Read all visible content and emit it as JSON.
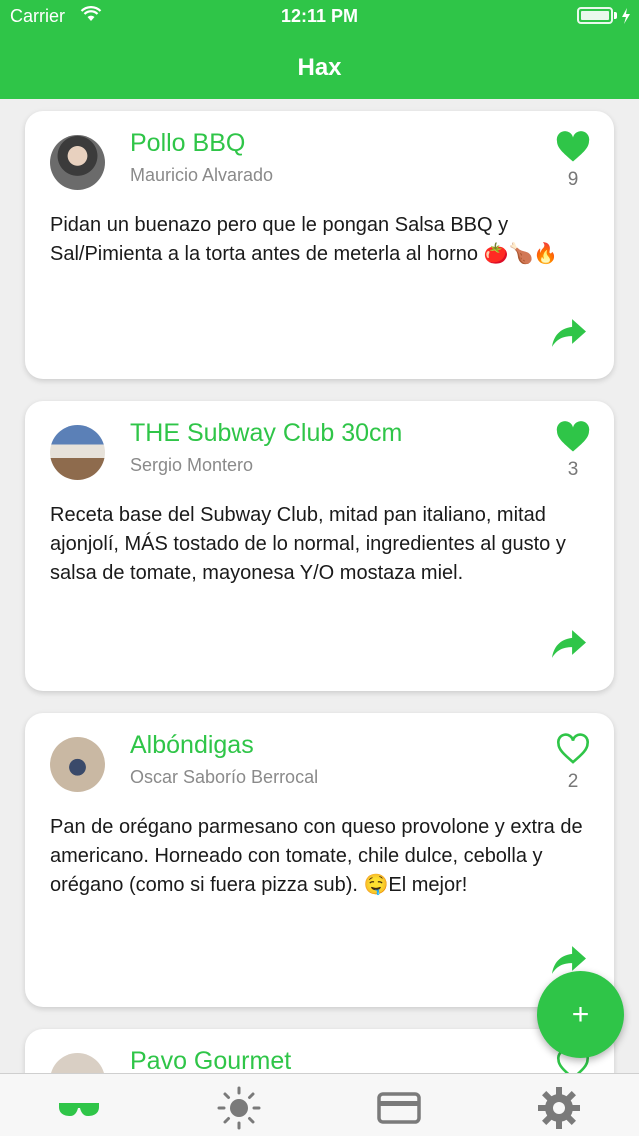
{
  "status_bar": {
    "carrier": "Carrier",
    "time": "12:11 PM"
  },
  "nav": {
    "title": "Hax"
  },
  "colors": {
    "accent": "#2fc548",
    "text": "#1a1a1a",
    "muted": "#8a8a8a"
  },
  "posts": [
    {
      "title": "Pollo BBQ",
      "author": "Mauricio Alvarado",
      "likes": "9",
      "liked": true,
      "body": "Pidan un buenazo pero que le pongan Salsa BBQ y Sal/Pimienta a la torta antes de meterla al horno 🍅🍗🔥"
    },
    {
      "title": "THE Subway Club 30cm",
      "author": "Sergio Montero",
      "likes": "3",
      "liked": true,
      "body": "Receta base del Subway Club, mitad pan italiano, mitad ajonjolí, MÁS tostado de lo normal, ingredientes al gusto y salsa de tomate, mayonesa Y/O mostaza miel."
    },
    {
      "title": "Albóndigas",
      "author": "Oscar Saborío Berrocal",
      "likes": "2",
      "liked": false,
      "body": "Pan de orégano parmesano con queso provolone y extra de americano. Horneado con tomate, chile dulce, cebolla y orégano (como si fuera pizza sub). 🤤El mejor!"
    },
    {
      "title": "Pavo Gourmet",
      "author": "",
      "likes": "",
      "liked": false,
      "body": ""
    }
  ],
  "fab": {
    "label": "+"
  },
  "tabs": [
    {
      "icon": "sunglasses-icon",
      "active": true
    },
    {
      "icon": "sun-icon",
      "active": false
    },
    {
      "icon": "credit-card-icon",
      "active": false
    },
    {
      "icon": "gear-icon",
      "active": false
    }
  ]
}
